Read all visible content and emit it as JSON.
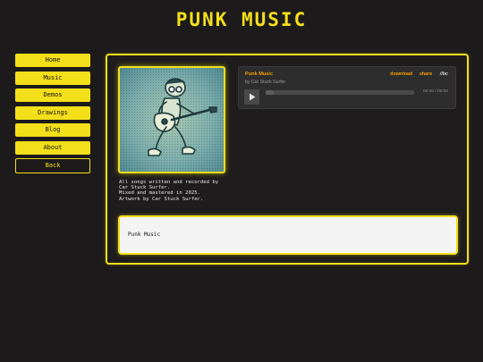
{
  "header": {
    "title": "PUNK MUSIC"
  },
  "nav": {
    "items": [
      {
        "label": "Home"
      },
      {
        "label": "Music"
      },
      {
        "label": "Demos"
      },
      {
        "label": "Drawings"
      },
      {
        "label": "Blog"
      },
      {
        "label": "About"
      }
    ],
    "back_label": "Back"
  },
  "player": {
    "track_title": "Punk Music",
    "artist": "by Car Stuck Surfer",
    "download_label": "download",
    "share_label": "share",
    "brand": "//bc",
    "time": "00:00 / 00:00",
    "progress": 0
  },
  "credits": "All songs written and recorded by\nCar Stuck Surfer.\nMixed and mastered in 2025.\nArtwork by Car Stuck Surfer.",
  "description": "Punk Music",
  "colors": {
    "accent": "#f4df1b",
    "background": "#1c1a1a",
    "player_link": "#f2a100"
  }
}
